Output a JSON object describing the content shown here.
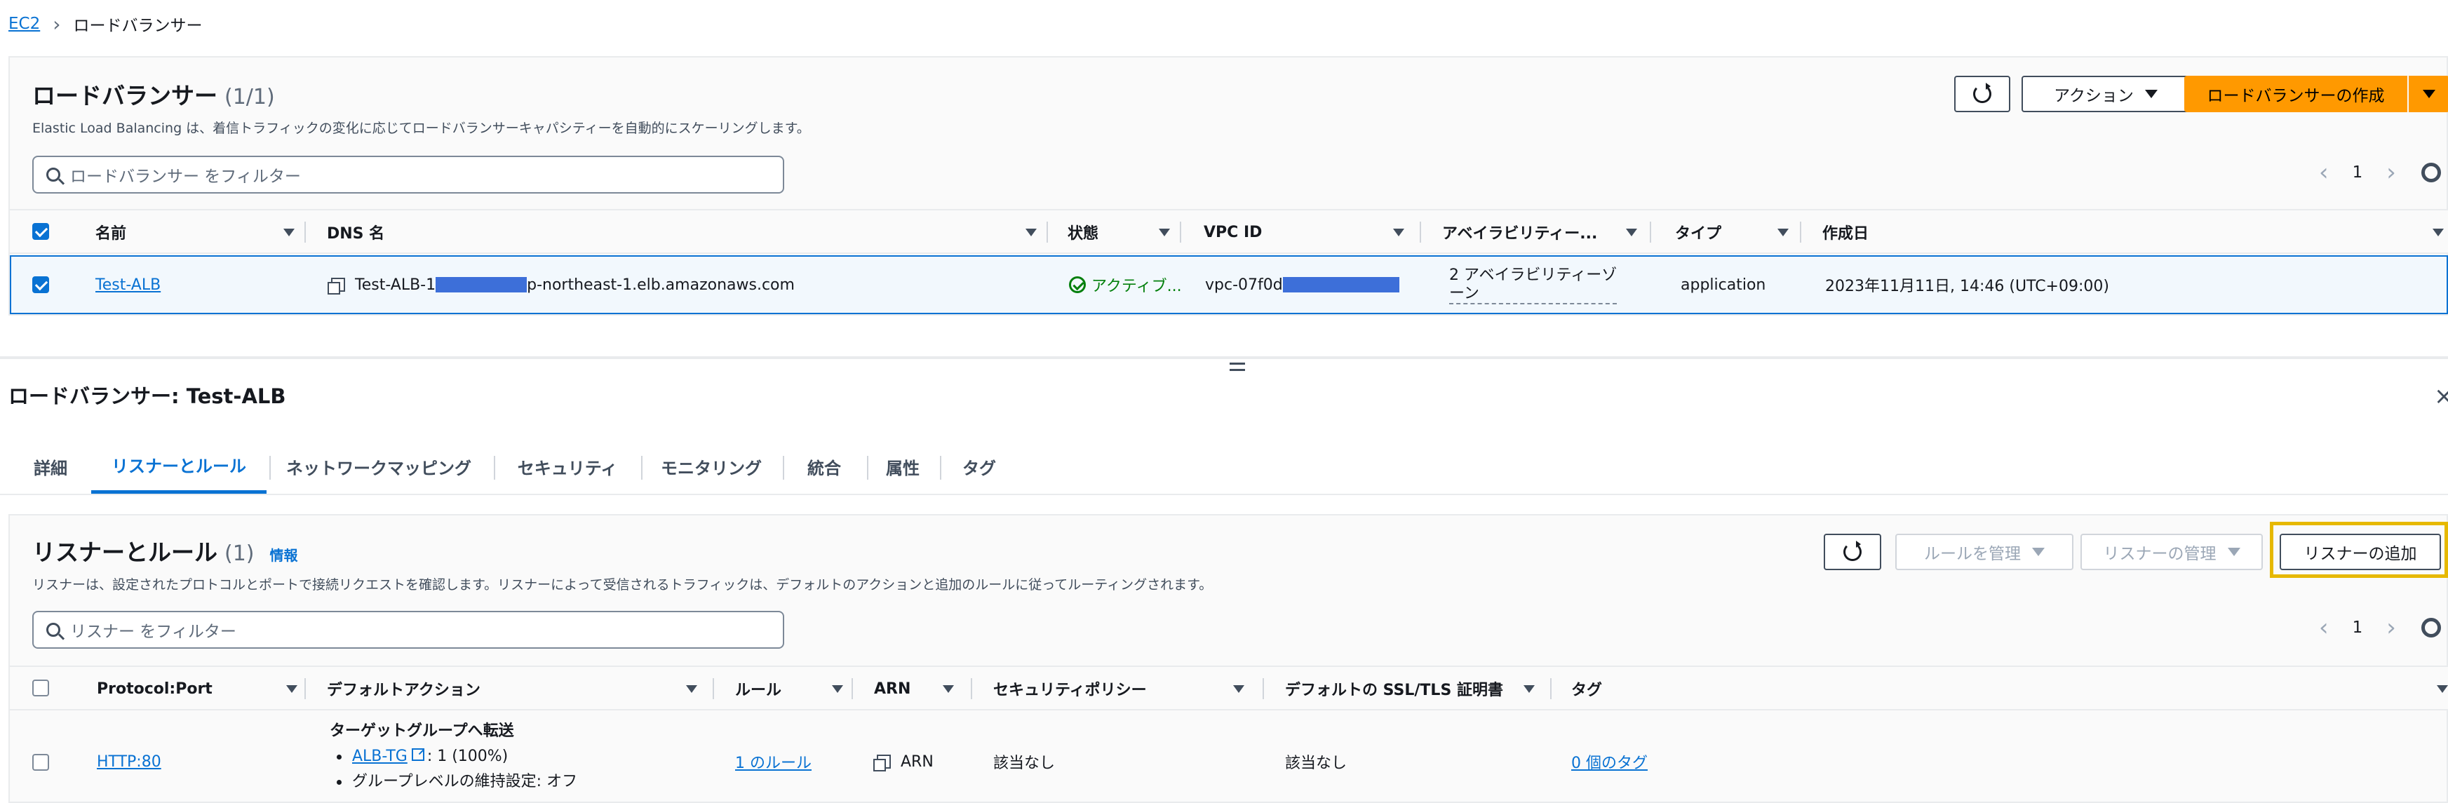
{
  "breadcrumb": {
    "root": "EC2",
    "current": "ロードバランサー"
  },
  "lb_panel": {
    "title": "ロードバランサー",
    "count": "(1/1)",
    "description": "Elastic Load Balancing は、着信トラフィックの変化に応じてロードバランサーキャパシティーを自動的にスケーリングします。",
    "filter_placeholder": "ロードバランサー をフィルター",
    "actions_label": "アクション",
    "create_label": "ロードバランサーの作成",
    "page": "1",
    "columns": {
      "name": "名前",
      "dns": "DNS 名",
      "state": "状態",
      "vpc": "VPC ID",
      "az": "アベイラビリティー...",
      "type": "タイプ",
      "created": "作成日"
    },
    "row": {
      "name": "Test-ALB",
      "dns_prefix": "Test-ALB-1",
      "dns_suffix": "p-northeast-1.elb.amazonaws.com",
      "state": "アクティブ...",
      "vpc_prefix": "vpc-07f0d",
      "az_line1": "2 アベイラビリティーゾ",
      "az_line2": "ーン",
      "type": "application",
      "created": "2023年11月11日, 14:46 (UTC+09:00)"
    }
  },
  "detail": {
    "title": "ロードバランサー: Test-ALB",
    "tabs": [
      "詳細",
      "リスナーとルール",
      "ネットワークマッピング",
      "セキュリティ",
      "モニタリング",
      "統合",
      "属性",
      "タグ"
    ],
    "active_tab": "リスナーとルール"
  },
  "listener_panel": {
    "title": "リスナーとルール",
    "count": "(1)",
    "info": "情報",
    "description": "リスナーは、設定されたプロトコルとポートで接続リクエストを確認します。リスナーによって受信されるトラフィックは、デフォルトのアクションと追加のルールに従ってルーティングされます。",
    "filter_placeholder": "リスナー をフィルター",
    "manage_rules_label": "ルールを管理",
    "manage_listener_label": "リスナーの管理",
    "add_listener_label": "リスナーの追加",
    "page": "1",
    "columns": {
      "protocol": "Protocol:Port",
      "default_action": "デフォルトアクション",
      "rules": "ルール",
      "arn": "ARN",
      "policy": "セキュリティポリシー",
      "cert": "デフォルトの SSL/TLS 証明書",
      "tags": "タグ"
    },
    "row": {
      "protocol": "HTTP:80",
      "action_title": "ターゲットグループへ転送",
      "tg_link": "ALB-TG",
      "tg_weight": ": 1 (100%)",
      "stickiness": "グループレベルの維持設定: オフ",
      "rules": "1 のルール",
      "arn": "ARN",
      "policy": "該当なし",
      "cert": "該当なし",
      "tags": "0 個のタグ"
    }
  }
}
